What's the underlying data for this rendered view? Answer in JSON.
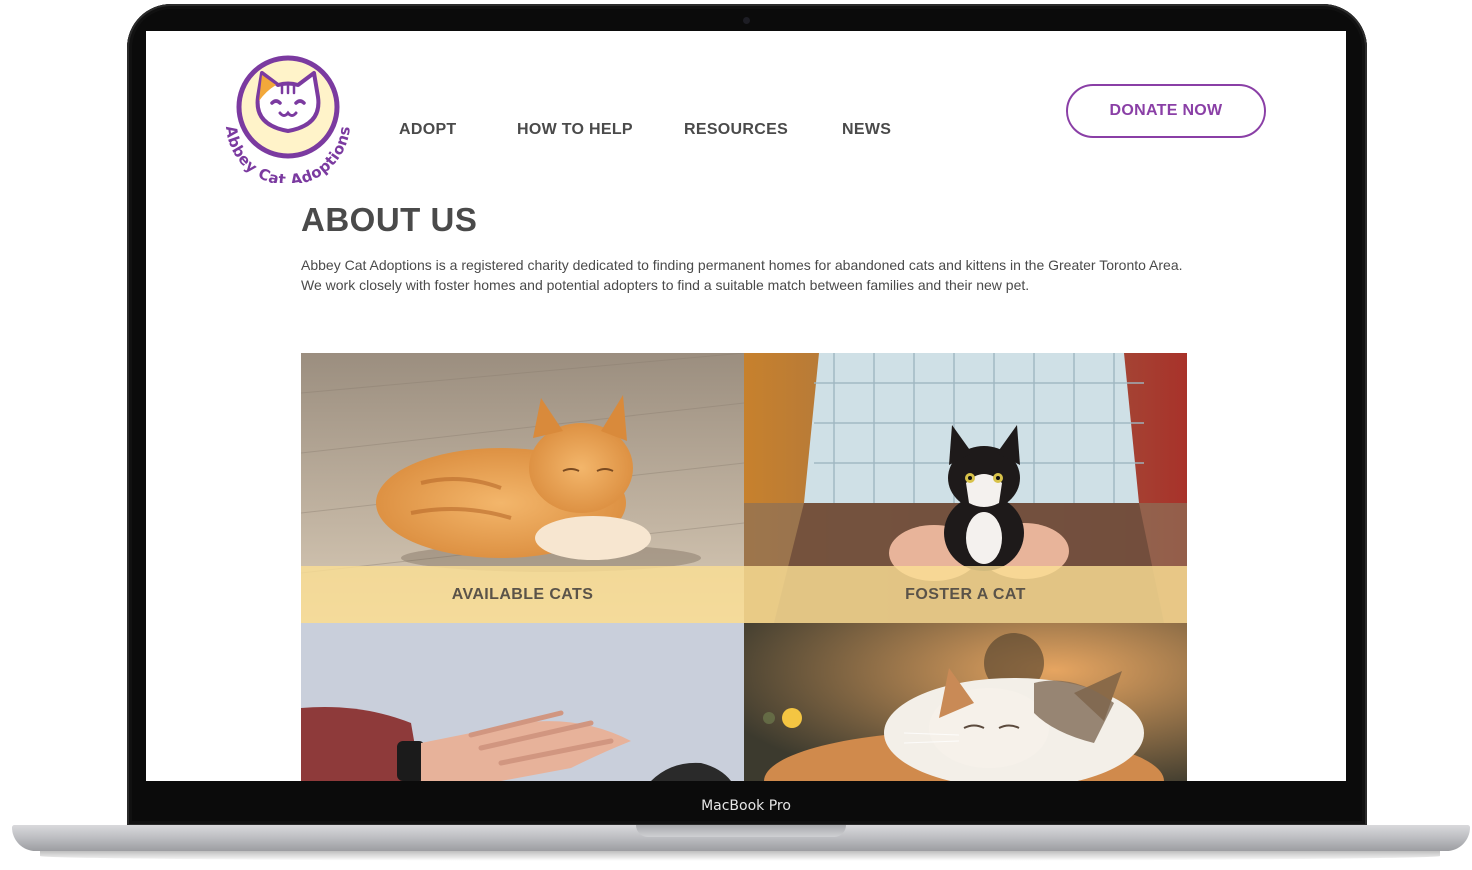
{
  "device": {
    "bezel_label": "MacBook Pro"
  },
  "brand": {
    "logo_text": "Abbey Cat Adoptions",
    "accent": "#8a3fa6",
    "band_color": "#fade94",
    "logo_face": "#fff3c9"
  },
  "nav": {
    "items": [
      {
        "label": "ADOPT"
      },
      {
        "label": "HOW TO HELP"
      },
      {
        "label": "RESOURCES"
      },
      {
        "label": "NEWS"
      }
    ],
    "donate_label": "DONATE NOW"
  },
  "about": {
    "title": "ABOUT US",
    "body": "Abbey Cat Adoptions is a registered charity dedicated to finding permanent homes for abandoned cats and kittens in the Greater Toronto Area. We work closely with foster homes and potential adopters to find a suitable match between families and their new pet."
  },
  "tiles": [
    {
      "label": "AVAILABLE CATS"
    },
    {
      "label": "FOSTER A CAT"
    }
  ]
}
